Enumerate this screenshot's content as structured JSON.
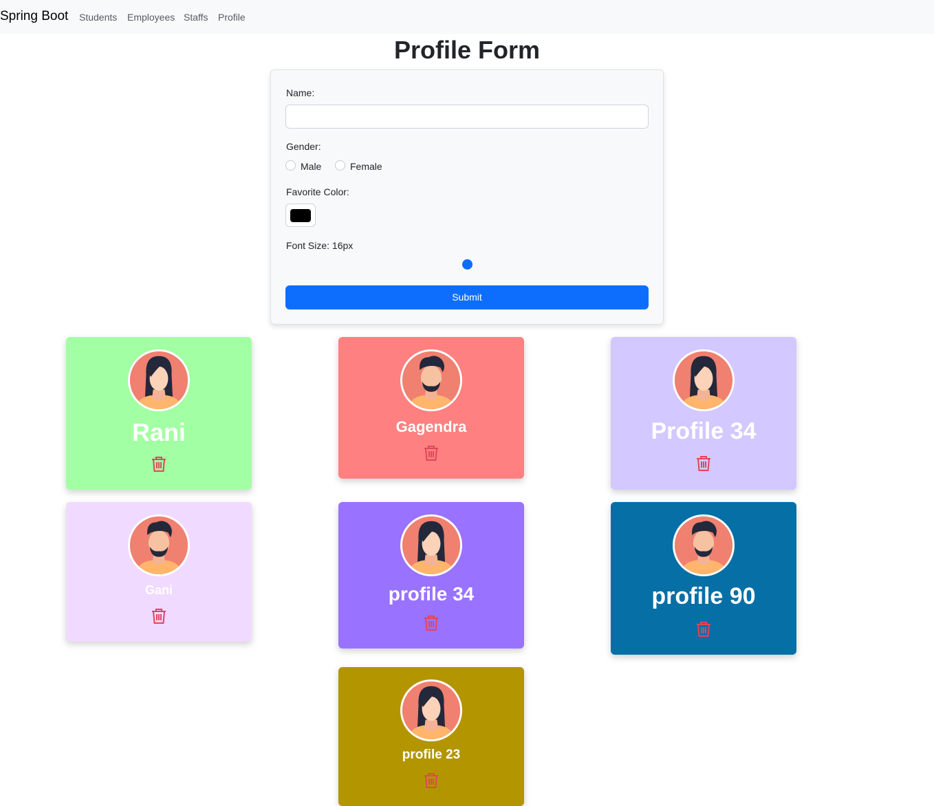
{
  "navbar": {
    "brand": "Spring Boot",
    "links": [
      "Students",
      "Employees",
      "Staffs",
      "Profile"
    ]
  },
  "page_title": "Profile Form",
  "form": {
    "name_label": "Name:",
    "name_value": "",
    "gender_label": "Gender:",
    "gender_options": [
      "Male",
      "Female"
    ],
    "color_label": "Favorite Color:",
    "color_value": "#000000",
    "font_size_label": "Font Size: 16px",
    "slider_fraction": 0.5,
    "submit_label": "Submit"
  },
  "profiles": [
    {
      "name": "Rani",
      "color": "#a3ffa3",
      "gender": "female",
      "delete_icon": "trash-icon"
    },
    {
      "name": "Gagendra",
      "color": "#ff8080",
      "gender": "male",
      "delete_icon": "trash-icon"
    },
    {
      "name": "Profile 34",
      "color": "#d3c8ff",
      "gender": "female",
      "delete_icon": "trash-icon"
    },
    {
      "name": "Gani",
      "color": "#f1daff",
      "gender": "male",
      "delete_icon": "trash-icon"
    },
    {
      "name": "profile 34",
      "color": "#9972ff",
      "gender": "female",
      "delete_icon": "trash-icon"
    },
    {
      "name": "profile 90",
      "color": "#066fa6",
      "gender": "male",
      "delete_icon": "trash-icon"
    },
    {
      "name": "profile 23",
      "color": "#b39500",
      "gender": "female",
      "delete_icon": "trash-icon"
    }
  ],
  "colors": {
    "primary": "#0d6efd",
    "trash": "#e0465a"
  }
}
